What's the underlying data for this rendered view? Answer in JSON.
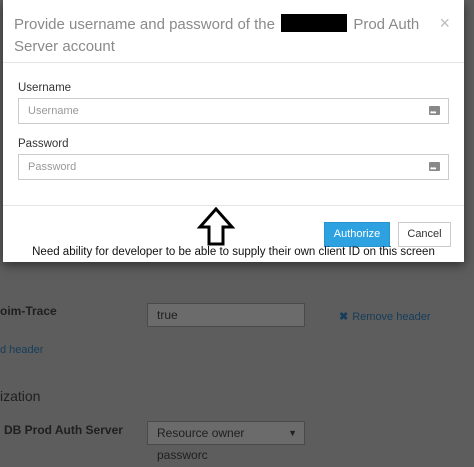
{
  "background": {
    "row1_label": "oim-Trace",
    "row1_value": "true",
    "remove_header": "Remove header",
    "add_header": "d header",
    "section_heading": "ization",
    "row2_label": "DB Prod Auth Server",
    "select_value": "Resource owner passworc"
  },
  "modal": {
    "title_before": "Provide username and password of the",
    "title_after": "Prod Auth Server account",
    "close_symbol": "×",
    "username_label": "Username",
    "username_placeholder": "Username",
    "password_label": "Password",
    "password_placeholder": "Password",
    "authorize_label": "Authorize",
    "cancel_label": "Cancel"
  },
  "annotation": {
    "note": "Need ability for developer to be able to supply their own client ID on this screen"
  }
}
